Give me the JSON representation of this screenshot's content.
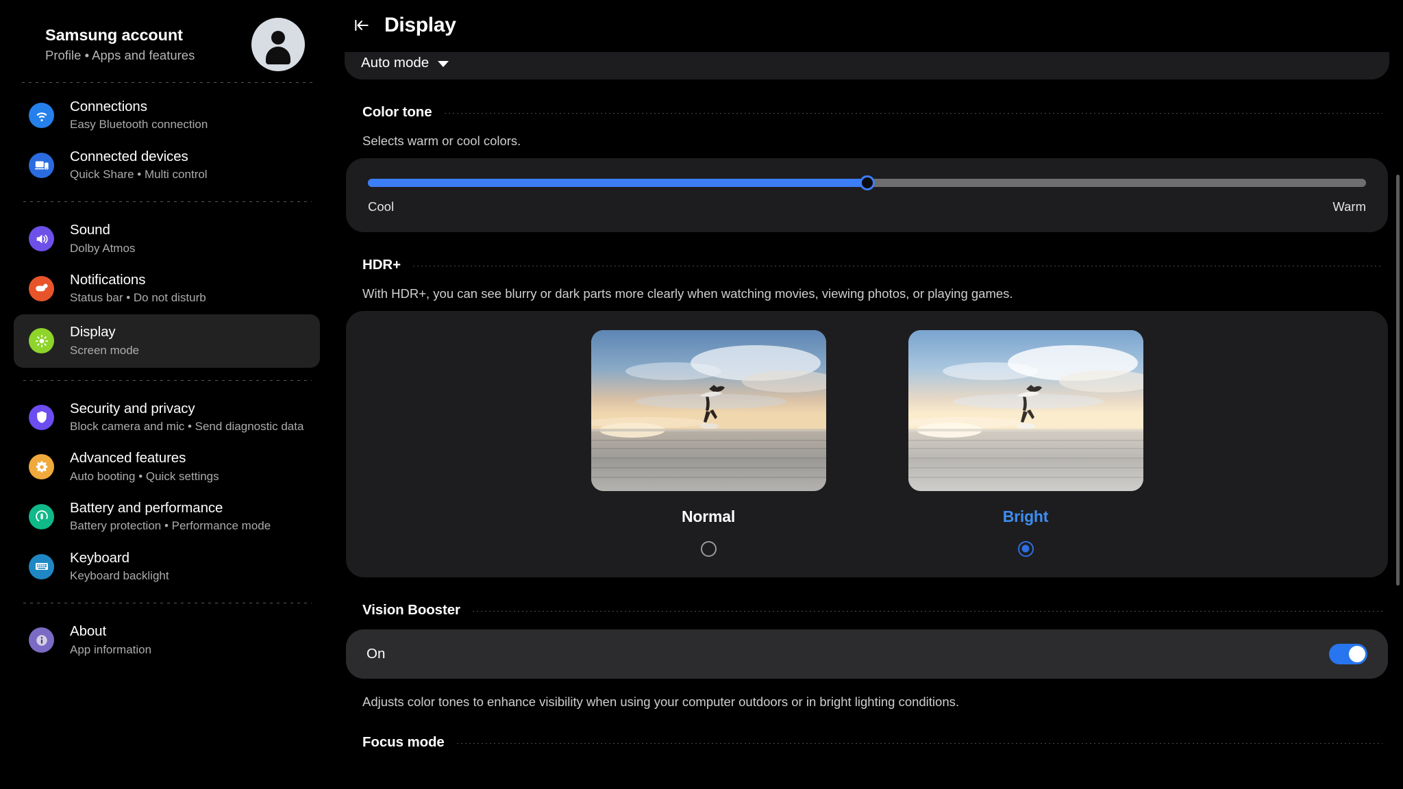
{
  "sidebar": {
    "account": {
      "title": "Samsung account",
      "subtitle": "Profile • Apps and features",
      "avatar_icon": "person-avatar-icon"
    },
    "items": [
      {
        "label": "Connections",
        "sublabel": "Easy Bluetooth connection",
        "icon": "wifi-icon",
        "color": "#2680eb",
        "selected": false
      },
      {
        "label": "Connected devices",
        "sublabel": "Quick Share  •  Multi control",
        "icon": "devices-icon",
        "color": "#2a6ce0",
        "selected": false
      },
      {
        "label": "Sound",
        "sublabel": "Dolby Atmos",
        "icon": "speaker-icon",
        "color": "#6c50e8",
        "selected": false
      },
      {
        "label": "Notifications",
        "sublabel": "Status bar • Do not disturb",
        "icon": "notification-icon",
        "color": "#e8542a",
        "selected": false
      },
      {
        "label": "Display",
        "sublabel": "Screen mode",
        "icon": "brightness-icon",
        "color": "#8ed42b",
        "selected": true
      },
      {
        "label": "Security and privacy",
        "sublabel": "Block camera and mic  •  Send diagnostic data",
        "icon": "shield-icon",
        "color": "#6b4df0",
        "selected": false
      },
      {
        "label": "Advanced features",
        "sublabel": "Auto booting  •  Quick settings",
        "icon": "gear-star-icon",
        "color": "#f0a93b",
        "selected": false
      },
      {
        "label": "Battery and performance",
        "sublabel": "Battery protection  •  Performance mode",
        "icon": "battery-icon",
        "color": "#10b98a",
        "selected": false
      },
      {
        "label": "Keyboard",
        "sublabel": "Keyboard backlight",
        "icon": "keyboard-icon",
        "color": "#1f88c4",
        "selected": false
      },
      {
        "label": "About",
        "sublabel": "App information",
        "icon": "info-icon",
        "color": "#7b6bc4",
        "selected": false
      }
    ]
  },
  "main": {
    "back_icon": "collapse-back-icon",
    "title": "Display",
    "auto_mode": {
      "label": "Auto mode",
      "caret_icon": "chevron-down-icon"
    },
    "color_tone": {
      "section_title": "Color tone",
      "description": "Selects warm or cool colors.",
      "slider": {
        "value_percent": 50,
        "min_label": "Cool",
        "max_label": "Warm",
        "fill_color": "#3c7ef7",
        "track_color": "#6e6e70"
      }
    },
    "hdr_plus": {
      "section_title": "HDR+",
      "description": "With HDR+, you can see blurry or dark parts more clearly when watching movies, viewing photos, or playing games.",
      "options": [
        {
          "label": "Normal",
          "selected": false
        },
        {
          "label": "Bright",
          "selected": true
        }
      ],
      "selected_color": "#3d8ef0"
    },
    "vision_booster": {
      "section_title": "Vision Booster",
      "toggle_label": "On",
      "toggle_on": true,
      "toggle_color": "#2776f0",
      "description": "Adjusts color tones to enhance visibility when using your computer outdoors or in bright lighting conditions."
    },
    "focus_mode": {
      "section_title": "Focus mode"
    }
  }
}
